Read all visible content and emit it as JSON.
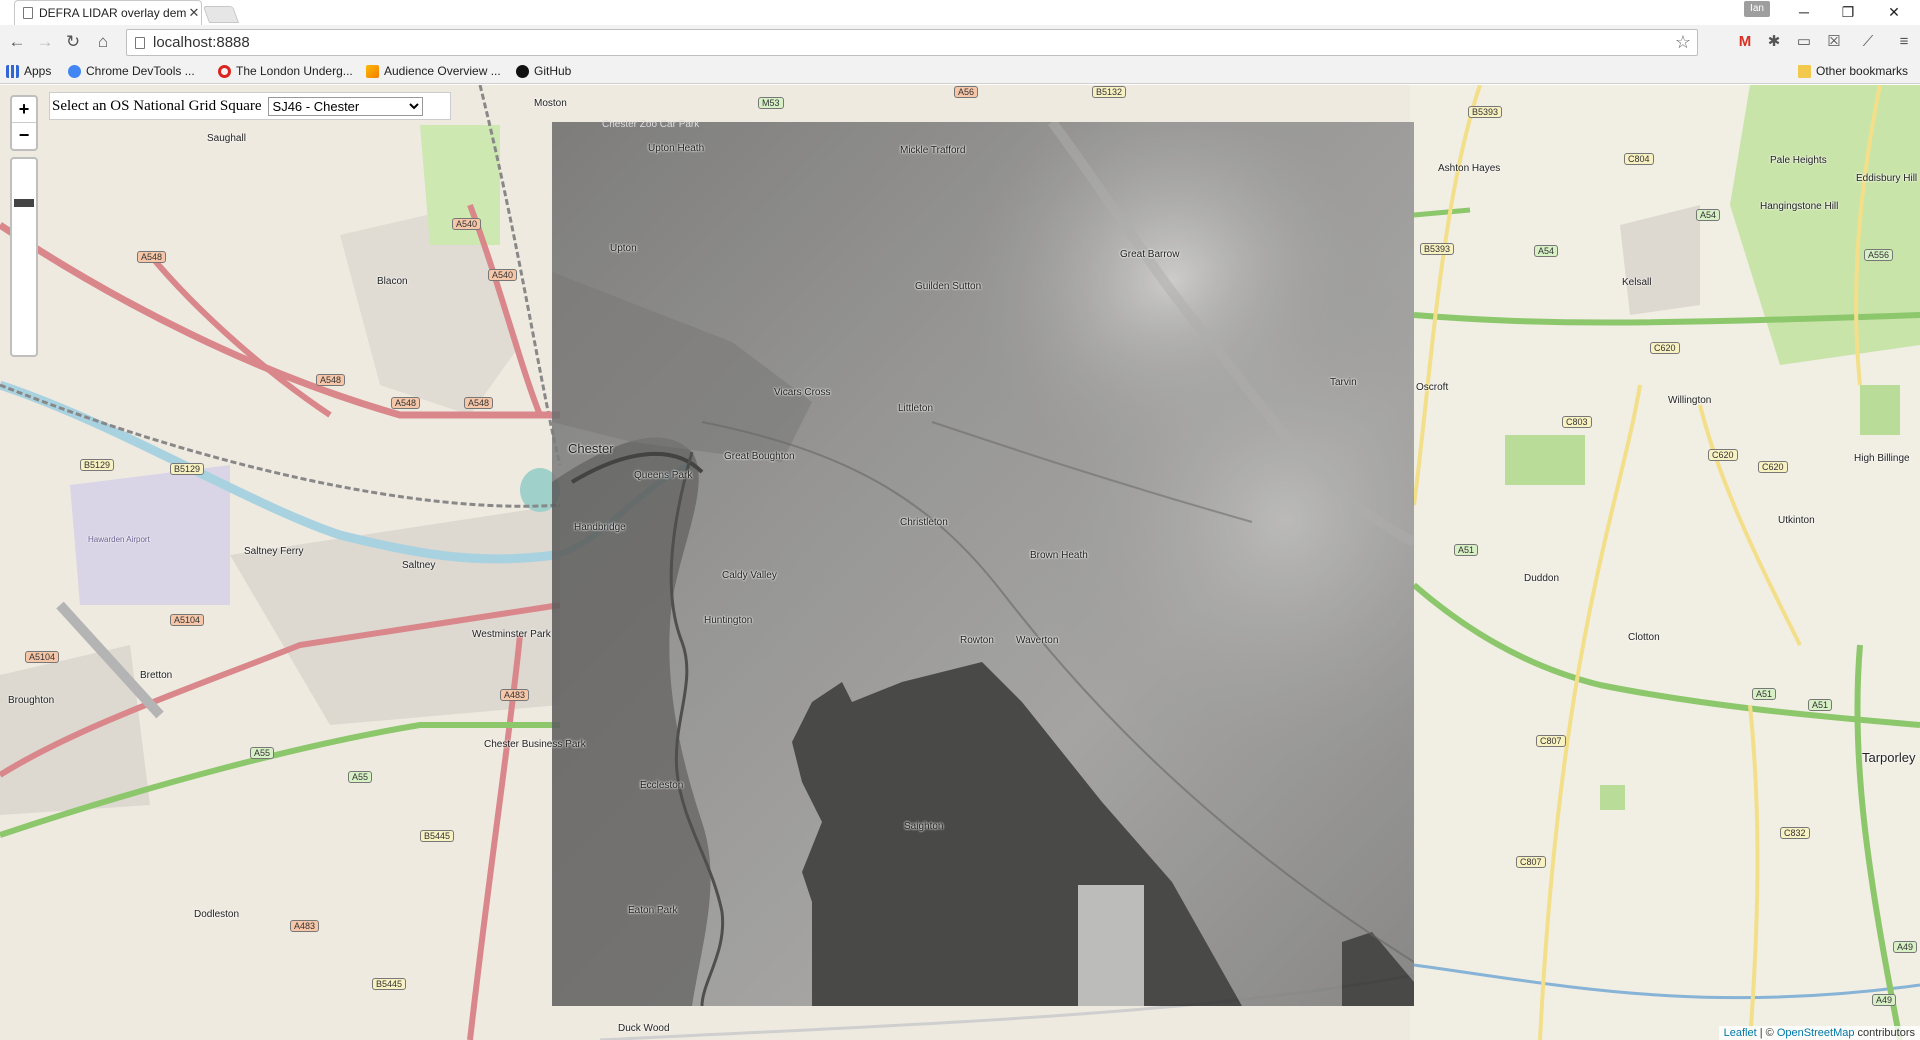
{
  "window": {
    "tab_title": "DEFRA LIDAR overlay dem",
    "tab_close": "✕",
    "user_badge": "Ian",
    "minimize": "─",
    "restore": "❐",
    "close": "✕"
  },
  "toolbar": {
    "url": "localhost:8888"
  },
  "bookmarks": {
    "items": [
      {
        "label": "Apps",
        "icon": "apps-grid-icon",
        "color": "#3367d6"
      },
      {
        "label": "Chrome DevTools ...",
        "icon": "devtools-gear-icon",
        "color": "#4285f4"
      },
      {
        "label": "The London Underg...",
        "icon": "tfl-roundel-icon",
        "color": "#dc241f"
      },
      {
        "label": "Audience Overview ...",
        "icon": "analytics-icon",
        "color": "#f57c00"
      },
      {
        "label": "GitHub",
        "icon": "github-icon",
        "color": "#000000"
      }
    ],
    "other": "Other bookmarks"
  },
  "map": {
    "zoom_in": "+",
    "zoom_out": "−",
    "grid_label": "Select an OS National Grid Square",
    "grid_selected": "SJ46 - Chester",
    "attribution": {
      "leaflet": "Leaflet",
      "sep": " | © ",
      "osm": "OpenStreetMap",
      "suffix": " contributors"
    },
    "places": {
      "moston": "Moston",
      "saughall": "Saughall",
      "blacon": "Blacon",
      "upton_heath": "Upton Heath",
      "mickle_trafford": "Mickle Trafford",
      "upton": "Upton",
      "guilden_sutton": "Guilden Sutton",
      "great_barrow": "Great Barrow",
      "ashton_hayes": "Ashton Hayes",
      "pale_heights": "Pale Heights",
      "eddisbury_hill": "Eddisbury Hill",
      "hangingstone_hill": "Hangingstone Hill",
      "kelsall": "Kelsall",
      "oscroft": "Oscroft",
      "willington": "Willington",
      "tarvin": "Tarvin",
      "chester": "Chester",
      "queens_park": "Queens Park",
      "great_boughton": "Great Boughton",
      "vicars_cross": "Vicars Cross",
      "littleton": "Littleton",
      "christleton": "Christleton",
      "handbridge": "Handbridge",
      "caldy_valley": "Caldy Valley",
      "huntington": "Huntington",
      "brown_heath": "Brown Heath",
      "rowton": "Rowton",
      "waverton": "Waverton",
      "saltney_ferry": "Saltney Ferry",
      "saltney": "Saltney",
      "hawarden_airport": "Hawarden Airport",
      "westminster_park": "Westminster Park",
      "bretton": "Bretton",
      "broughton": "Broughton",
      "chester_business_park": "Chester Business Park",
      "eccleston": "Eccleston",
      "saighton": "Saighton",
      "dodleston": "Dodleston",
      "duddon": "Duddon",
      "utkinton": "Utkinton",
      "high_billinge": "High Billinge",
      "clotton": "Clotton",
      "tarporley": "Tarporley",
      "duck_wood": "Duck Wood",
      "chester_zoo": "Chester Zoo Car Park",
      "eaton_park": "Eaton Park"
    },
    "roads": {
      "a56": "A56",
      "b5132": "B5132",
      "m53": "M53",
      "b5393": "B5393",
      "b5393b": "B5393",
      "a540": "A540",
      "a540b": "A540",
      "a548": "A548",
      "a548b": "A548",
      "a548c": "A548",
      "a548d": "A548",
      "c804": "C804",
      "a54": "A54",
      "a54b": "A54",
      "a556": "A556",
      "c620": "C620",
      "c803": "C803",
      "c620b": "C620",
      "c620c": "C620",
      "b5129": "B5129",
      "b5129b": "B5129",
      "a5104": "A5104",
      "a5104b": "A5104",
      "a483": "A483",
      "a483b": "A483",
      "a55": "A55",
      "a55b": "A55",
      "b5445": "B5445",
      "b5445b": "B5445",
      "a51": "A51",
      "a51b": "A51",
      "a51c": "A51",
      "c807": "C807",
      "c807b": "C807",
      "c832": "C832",
      "a49": "A49",
      "a49b": "A49"
    }
  }
}
